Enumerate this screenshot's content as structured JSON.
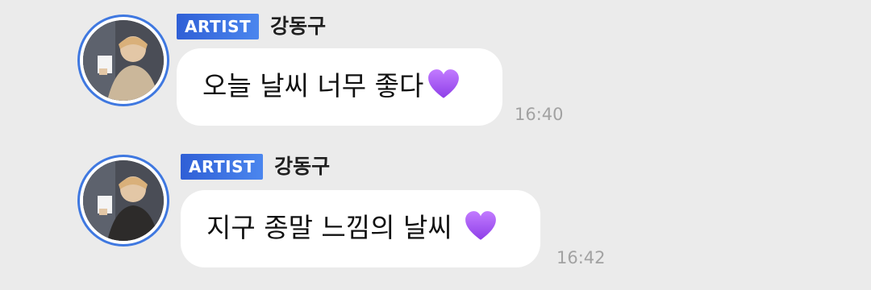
{
  "colors": {
    "background": "#ebebeb",
    "badge": "#3a6fe3",
    "avatar_ring": "#3f78e0",
    "heart": "#a24ff0",
    "timestamp": "#a2a2a2"
  },
  "messages": [
    {
      "badge": "ARTIST",
      "sender": "강동구",
      "avatar_icon": "avatar-photo",
      "text": "오늘 날씨 너무 좋다",
      "emoji": "purple-heart-icon",
      "time": "16:40"
    },
    {
      "badge": "ARTIST",
      "sender": "강동구",
      "avatar_icon": "avatar-photo",
      "text": "지구 종말 느낌의 날씨",
      "emoji": "purple-heart-icon",
      "time": "16:42"
    }
  ]
}
